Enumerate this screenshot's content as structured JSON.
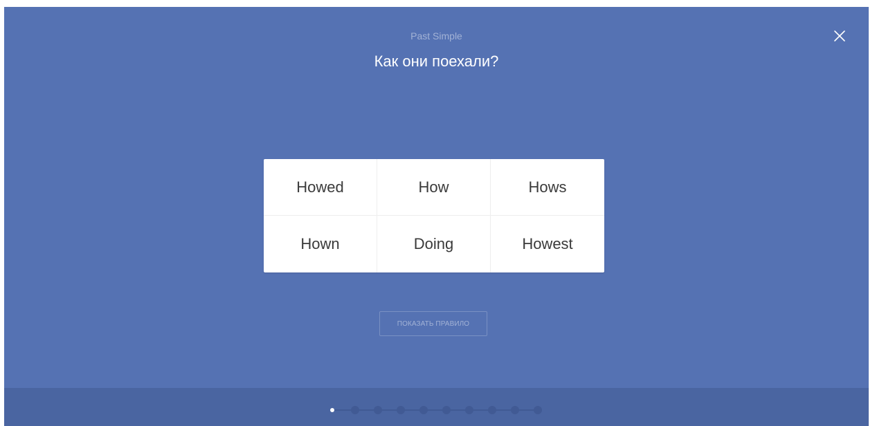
{
  "header": {
    "topic": "Past Simple",
    "question": "Как они поехали?"
  },
  "close": {
    "icon": "close-icon"
  },
  "options": [
    "Howed",
    "How",
    "Hows",
    "Hown",
    "Doing",
    "Howest"
  ],
  "show_rule_label": "ПОКАЗАТЬ ПРАВИЛО",
  "progress": {
    "total_steps": 10,
    "current_step": 1
  },
  "colors": {
    "background": "#5572b3",
    "footer": "#4a65a1",
    "card": "#ffffff",
    "option_text": "#3a3a3a",
    "dot_active": "#ffffff",
    "dot_inactive": "#415a94"
  }
}
